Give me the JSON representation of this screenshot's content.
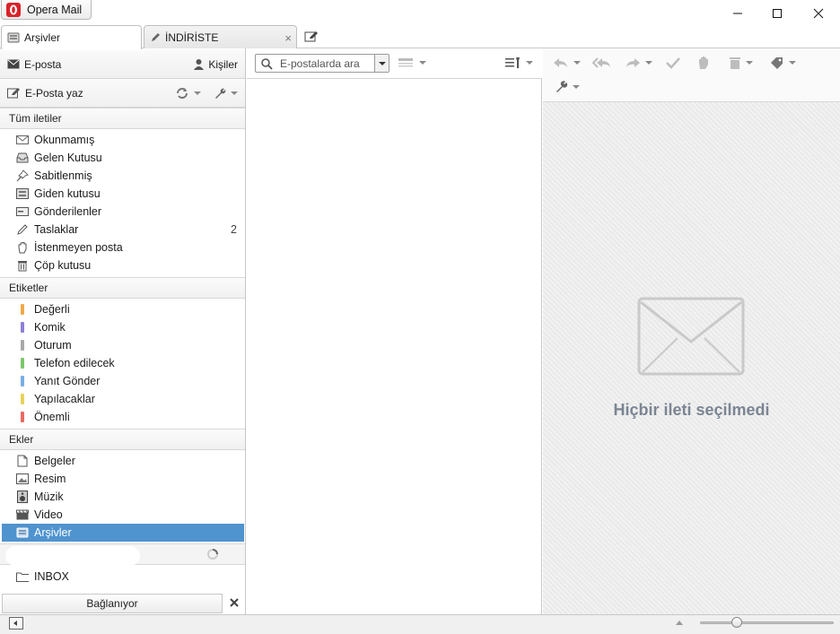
{
  "app": {
    "title": "Opera Mail"
  },
  "window_controls": {
    "minimize": "–",
    "maximize": "☐",
    "close": "✕"
  },
  "tabs": [
    {
      "label": "Arşivler"
    },
    {
      "label": "İNDİRİSTE"
    }
  ],
  "left_panel": {
    "email_label": "E-posta",
    "contacts_label": "Kişiler",
    "compose_label": "E-Posta yaz",
    "sections": {
      "all_messages": "Tüm iletiler",
      "labels": "Etiketler",
      "attachments": "Ekler"
    },
    "mail_items": [
      {
        "label": "Okunmamış",
        "icon": "envelope-icon"
      },
      {
        "label": "Gelen Kutusu",
        "icon": "inbox-icon"
      },
      {
        "label": "Sabitlenmiş",
        "icon": "pin-icon"
      },
      {
        "label": "Giden kutusu",
        "icon": "outbox-icon"
      },
      {
        "label": "Gönderilenler",
        "icon": "sent-icon"
      },
      {
        "label": "Taslaklar",
        "icon": "pencil-icon",
        "count": "2"
      },
      {
        "label": "İstenmeyen posta",
        "icon": "hand-icon"
      },
      {
        "label": "Çöp kutusu",
        "icon": "trash-icon"
      }
    ],
    "label_items": [
      {
        "label": "Değerli",
        "color": "#f0a94a"
      },
      {
        "label": "Komik",
        "color": "#8e7fd6"
      },
      {
        "label": "Oturum",
        "color": "#a9a9a9"
      },
      {
        "label": "Telefon edilecek",
        "color": "#7cc86a"
      },
      {
        "label": "Yanıt Gönder",
        "color": "#77aee6"
      },
      {
        "label": "Yapılacaklar",
        "color": "#e6d35c"
      },
      {
        "label": "Önemli",
        "color": "#e86a63"
      }
    ],
    "attachment_items": [
      {
        "label": "Belgeler",
        "icon": "document-icon"
      },
      {
        "label": "Resim",
        "icon": "image-icon"
      },
      {
        "label": "Müzik",
        "icon": "speaker-icon"
      },
      {
        "label": "Video",
        "icon": "clapper-icon"
      },
      {
        "label": "Arşivler",
        "icon": "archive-icon",
        "selected": true
      }
    ],
    "inbox_folder": "INBOX",
    "connect_button": "Bağlanıyor"
  },
  "search": {
    "placeholder": "E-postalarda ara"
  },
  "preview": {
    "empty_message": "Hiçbir ileti seçilmedi"
  },
  "colors": {
    "selection": "#4f93cf",
    "opera_red": "#d9222a"
  }
}
